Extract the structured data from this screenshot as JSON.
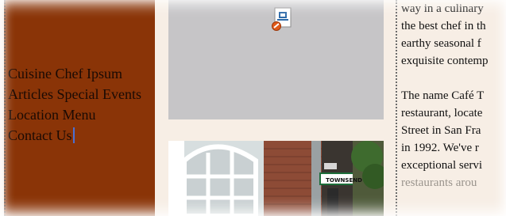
{
  "sidebar": {
    "nav_lines": [
      [
        "Cuisine",
        "Chef",
        "Ipsum"
      ],
      [
        "Articles",
        "Special Events"
      ],
      [
        "Location",
        "Menu"
      ],
      [
        "Contact Us"
      ]
    ]
  },
  "media": {
    "plugin_icon": "plugin-placeholder-icon",
    "photo_sign_text": "TOWNSEND"
  },
  "content": {
    "paragraph1": [
      "way in a culinary",
      "the best chef in th",
      "earthy seasonal f",
      "exquisite contemp"
    ],
    "paragraph2": [
      "The name Café T",
      "restaurant, locate",
      "Street in San Fra",
      "in 1992. We've r",
      "exceptional servi",
      "restaurants arou"
    ]
  },
  "colors": {
    "sidebar": "#8a3407",
    "background": "#f7eee5",
    "placeholder": "#c6c5c7",
    "caret": "#4a6fd3"
  }
}
